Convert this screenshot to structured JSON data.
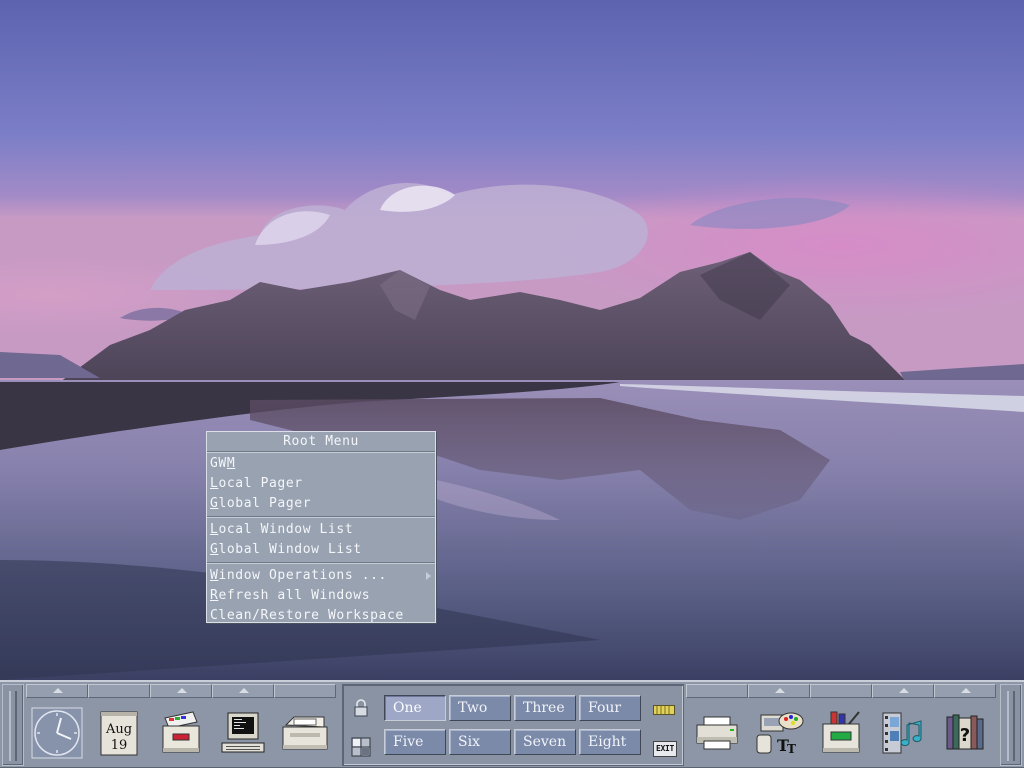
{
  "menu": {
    "title": "Root Menu",
    "groups": [
      [
        {
          "pre": "GW",
          "u": "M",
          "post": ""
        },
        {
          "pre": "",
          "u": "L",
          "post": "ocal Pager"
        },
        {
          "pre": "",
          "u": "G",
          "post": "lobal Pager"
        }
      ],
      [
        {
          "pre": "",
          "u": "L",
          "post": "ocal Window List"
        },
        {
          "pre": "",
          "u": "G",
          "post": "lobal Window List"
        }
      ],
      [
        {
          "pre": "",
          "u": "W",
          "post": "indow Operations ...",
          "submenu": true
        },
        {
          "pre": "",
          "u": "R",
          "post": "efresh all Windows"
        },
        {
          "pre": "",
          "u": "",
          "post": "Clean/Restore Workspace"
        }
      ]
    ]
  },
  "panel": {
    "calendar": {
      "month": "Aug",
      "day": "19"
    },
    "workspaces": [
      "One",
      "Two",
      "Three",
      "Four",
      "Five",
      "Six",
      "Seven",
      "Eight"
    ],
    "active_workspace": "One",
    "exit_label": "EXIT"
  },
  "icons": {
    "left": [
      "clock-icon",
      "calendar-icon",
      "file-manager-icon",
      "terminal-icon",
      "mailer-icon"
    ],
    "right": [
      "printer-icon",
      "style-manager-icon",
      "application-manager-icon",
      "multimedia-icon",
      "help-manager-icon"
    ]
  },
  "colors": {
    "panel": "#8d96a6",
    "menu": "#98a2b1",
    "workspace_button": "#7c8aaa",
    "workspace_active": "#9ea8c6"
  }
}
